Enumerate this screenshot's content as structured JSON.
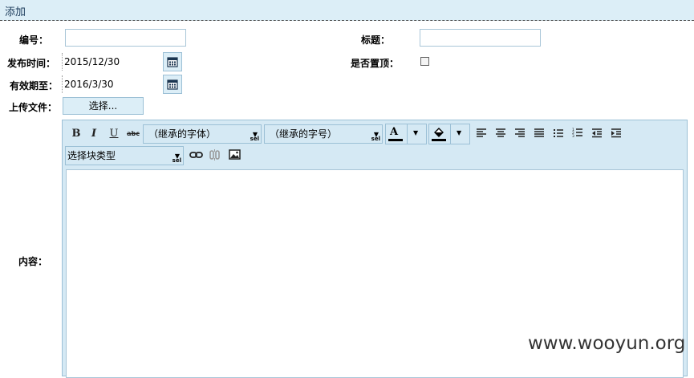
{
  "panel": {
    "title": "添加"
  },
  "form": {
    "number_label": "编号：",
    "title_label": "标题：",
    "publish_time_label": "发布时间：",
    "publish_time_value": "2015/12/30",
    "pin_label": "是否置顶：",
    "valid_until_label": "有效期至：",
    "valid_until_value": "2016/3/30",
    "upload_label": "上传文件：",
    "upload_button": "选择...",
    "content_label": "内容："
  },
  "editor": {
    "font_family": "（继承的字体）",
    "font_size": "（继承的字号）",
    "block_type": "选择块类型",
    "sel_text": "sel",
    "bold": "B",
    "italic": "I",
    "underline": "U",
    "strike": "abc",
    "font_color_glyph": "A"
  },
  "watermark": "www.wooyun.org",
  "colors": {
    "titlebar_bg": "#dceef7",
    "toolbar_bg": "#d5e9f4",
    "border": "#9cc0d6"
  },
  "icons": [
    "calendar-icon",
    "bold-icon",
    "italic-icon",
    "underline-icon",
    "strikethrough-icon",
    "font-color-icon",
    "highlight-color-icon",
    "align-left-icon",
    "align-center-icon",
    "align-right-icon",
    "justify-icon",
    "bullet-list-icon",
    "numbered-list-icon",
    "outdent-icon",
    "indent-icon",
    "link-icon",
    "unlink-icon",
    "image-icon"
  ]
}
